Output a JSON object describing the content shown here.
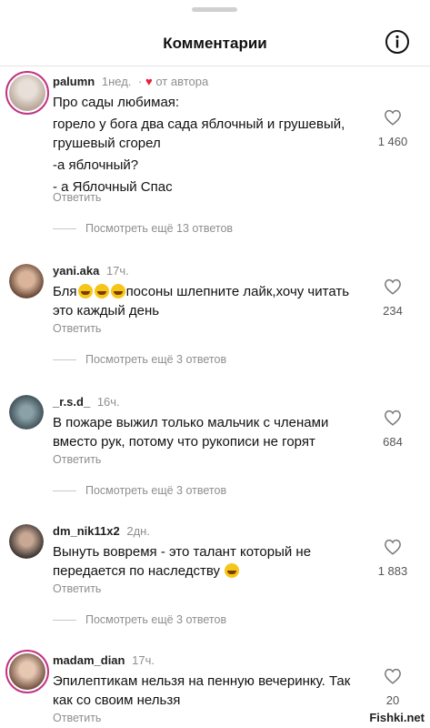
{
  "header": {
    "title": "Комментарии",
    "info_icon": "info-icon"
  },
  "comments": [
    {
      "user": "palumn",
      "time": "1нед.",
      "author_note": "от автора",
      "lines": [
        "Про сады любимая:",
        "горело у бога два сада яблочный и грушевый, грушевый сгорел",
        "-а яблочный?",
        "- а Яблочный Спас"
      ],
      "reply": "Ответить",
      "likes": "1 460",
      "more_replies": "Посмотреть ещё 13 ответов"
    },
    {
      "user": "yani.aka",
      "time": "17ч.",
      "text_before": "Бля",
      "text_after": "посоны шлепните лайк,хочу читать это каждый день",
      "reply": "Ответить",
      "likes": "234",
      "more_replies": "Посмотреть ещё 3 ответов"
    },
    {
      "user": "_r.s.d_",
      "time": "16ч.",
      "lines": [
        "В пожаре выжил только мальчик с членами вместо рук, потому что рукописи не горят"
      ],
      "reply": "Ответить",
      "likes": "684",
      "more_replies": "Посмотреть ещё 3 ответов"
    },
    {
      "user": "dm_nik11x2",
      "time": "2дн.",
      "text_before": "Вынуть вовремя - это талант который не передается по наследству",
      "reply": "Ответить",
      "likes": "1 883",
      "more_replies": "Посмотреть ещё 3 ответов"
    },
    {
      "user": "madam_dian",
      "time": "17ч.",
      "lines": [
        "Эпилептикам нельзя на пенную вечеринку. Так как со своим нельзя"
      ],
      "reply": "Ответить",
      "likes": "20"
    }
  ],
  "watermark": "Fishki.net",
  "colors": {
    "accent_red": "#ed1c3a",
    "secondary_text": "#8e8e8e",
    "story_ring": "#c13584"
  }
}
